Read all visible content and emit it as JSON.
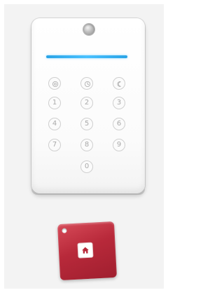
{
  "keypad": {
    "keys": [
      {
        "label": "",
        "icon": "shield-away-icon"
      },
      {
        "label": "",
        "icon": "shield-home-icon"
      },
      {
        "label": "",
        "icon": "moon-icon"
      },
      {
        "label": "1"
      },
      {
        "label": "2"
      },
      {
        "label": "3"
      },
      {
        "label": "4"
      },
      {
        "label": "5"
      },
      {
        "label": "6"
      },
      {
        "label": "7"
      },
      {
        "label": "8"
      },
      {
        "label": "9"
      },
      {
        "label": "0"
      }
    ],
    "led_color": "#49c1ff"
  },
  "fob": {
    "color": "#b8293a",
    "button_icon": "home-icon"
  }
}
